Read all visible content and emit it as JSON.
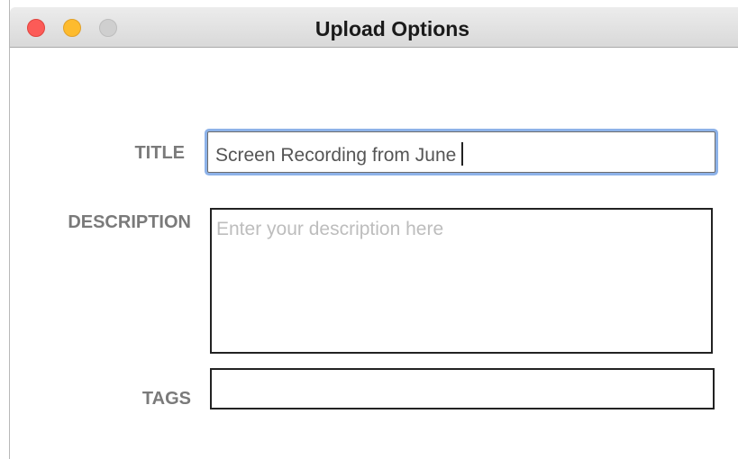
{
  "window": {
    "title": "Upload Options"
  },
  "form": {
    "title_label": "TITLE",
    "title_value": "Screen Recording from June",
    "description_label": "DESCRIPTION",
    "description_value": "",
    "description_placeholder": "Enter your description here",
    "tags_label": "TAGS",
    "tags_value": ""
  },
  "colors": {
    "close": "#fc5b57",
    "minimize": "#fdbb2e",
    "zoom": "#cfcfcf",
    "focus_ring": "#8db2e8"
  },
  "icons": [
    "close-icon",
    "minimize-icon",
    "zoom-icon"
  ]
}
